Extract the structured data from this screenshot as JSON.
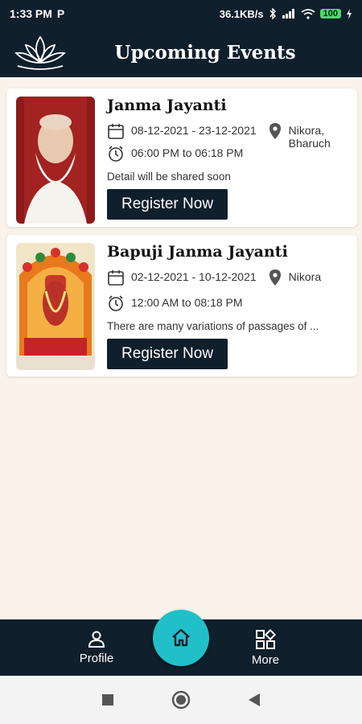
{
  "status_bar": {
    "time": "1:33 PM",
    "app_badge": "P",
    "network_speed": "36.1KB/s",
    "battery": "100"
  },
  "app_bar": {
    "title": "Upcoming Events"
  },
  "events": [
    {
      "title": "Janma Jayanti",
      "date_range": "08-12-2021 - 23-12-2021",
      "location_line1": "Nikora,",
      "location_line2": "Bharuch",
      "time_range": "06:00 PM to 06:18 PM",
      "detail": "Detail will be shared soon",
      "register_label": "Register Now"
    },
    {
      "title": "Bapuji Janma Jayanti",
      "date_range": "02-12-2021 - 10-12-2021",
      "location_line1": "Nikora",
      "location_line2": "",
      "time_range": "12:00 AM to 08:18 PM",
      "detail": "There are many variations of passages of ...",
      "register_label": "Register Now"
    }
  ],
  "bottom_nav": {
    "profile_label": "Profile",
    "more_label": "More"
  },
  "colors": {
    "primary_dark": "#0f1f2c",
    "accent_teal": "#21c0c8",
    "background": "#faf3ea"
  }
}
